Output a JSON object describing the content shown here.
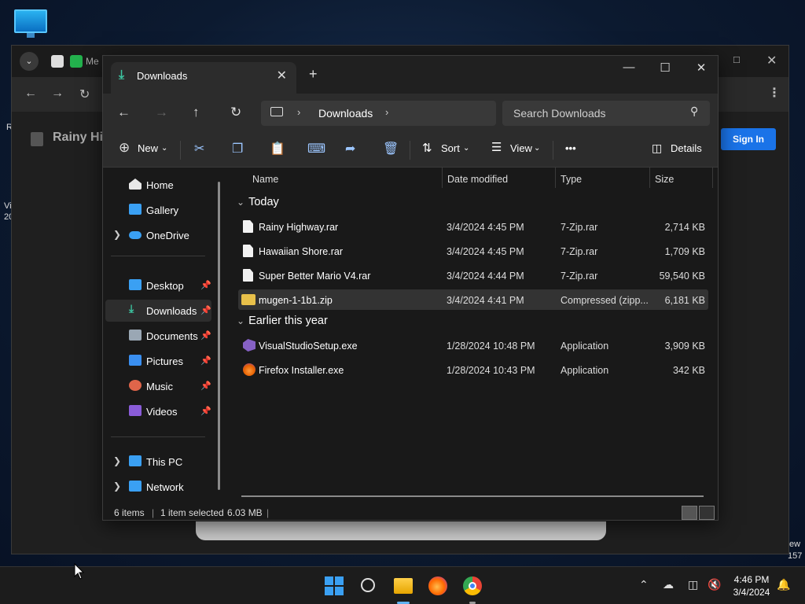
{
  "desktop": {
    "edge_texts": [
      "R",
      "Vi",
      "20",
      "ew",
      "157"
    ]
  },
  "browser": {
    "bg_title": "Rainy Hig",
    "signin_label": "Sign In",
    "tab_snip": "Me"
  },
  "explorer": {
    "tab_label": "Downloads",
    "breadcrumb": "Downloads",
    "search_placeholder": "Search Downloads",
    "toolbar": {
      "new_label": "New",
      "sort_label": "Sort",
      "view_label": "View",
      "more_label": "•••",
      "details_label": "Details"
    },
    "sidebar": {
      "items": [
        {
          "label": "Home",
          "color": "#e8e8e8"
        },
        {
          "label": "Gallery",
          "color": "#3aa0f3"
        },
        {
          "label": "OneDrive",
          "color": "#3aa0f3"
        },
        {
          "label": "Desktop",
          "color": "#3aa0f3"
        },
        {
          "label": "Downloads",
          "color": "#3cc3a0"
        },
        {
          "label": "Documents",
          "color": "#9aa7b4"
        },
        {
          "label": "Pictures",
          "color": "#3a8ff0"
        },
        {
          "label": "Music",
          "color": "#e0654a"
        },
        {
          "label": "Videos",
          "color": "#8a5cd8"
        },
        {
          "label": "This PC",
          "color": "#3aa0f3"
        },
        {
          "label": "Network",
          "color": "#3aa0f3"
        }
      ]
    },
    "columns": {
      "name": "Name",
      "date": "Date modified",
      "type": "Type",
      "size": "Size"
    },
    "groups": [
      {
        "label": "Today"
      },
      {
        "label": "Earlier this year"
      }
    ],
    "files": [
      {
        "name": "Rainy Highway.rar",
        "date": "3/4/2024 4:45 PM",
        "type": "7-Zip.rar",
        "size": "2,714 KB",
        "icon": "document-icon"
      },
      {
        "name": "Hawaiian Shore.rar",
        "date": "3/4/2024 4:45 PM",
        "type": "7-Zip.rar",
        "size": "1,709 KB",
        "icon": "document-icon"
      },
      {
        "name": "Super Better Mario V4.rar",
        "date": "3/4/2024 4:44 PM",
        "type": "7-Zip.rar",
        "size": "59,540 KB",
        "icon": "document-icon"
      },
      {
        "name": "mugen-1-1b1.zip",
        "date": "3/4/2024 4:41 PM",
        "type": "Compressed (zipp...",
        "size": "6,181 KB",
        "icon": "zip-folder-icon"
      },
      {
        "name": "VisualStudioSetup.exe",
        "date": "1/28/2024 10:48 PM",
        "type": "Application",
        "size": "3,909 KB",
        "icon": "visual-studio-icon"
      },
      {
        "name": "Firefox Installer.exe",
        "date": "1/28/2024 10:43 PM",
        "type": "Application",
        "size": "342 KB",
        "icon": "firefox-icon"
      }
    ],
    "status": {
      "items": "6 items",
      "selected": "1 item selected",
      "size": "6.03 MB"
    }
  },
  "taskbar": {
    "time": "4:46 PM",
    "date": "3/4/2024"
  },
  "colors": {
    "accent": "#3aa0f3",
    "signin": "#1a73e8",
    "window_bg": "#191919"
  }
}
